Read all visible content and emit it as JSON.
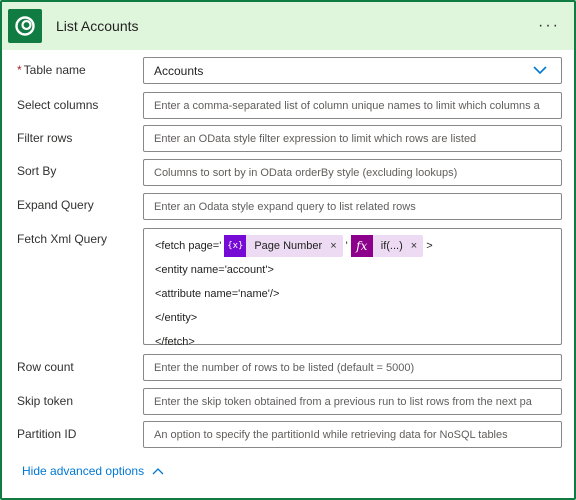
{
  "header": {
    "title": "List Accounts",
    "more_label": "···"
  },
  "colors": {
    "border": "#107c41",
    "header_bg": "#dff6dd",
    "link": "#0078d4",
    "variable_token": "#770bd6",
    "expression_token": "#8c008c",
    "token_bg": "#ecdbf3"
  },
  "fields": {
    "table_name": {
      "label": "Table name",
      "required_mark": "*",
      "value": "Accounts"
    },
    "select_columns": {
      "label": "Select columns",
      "placeholder": "Enter a comma-separated list of column unique names to limit which columns a"
    },
    "filter_rows": {
      "label": "Filter rows",
      "placeholder": "Enter an OData style filter expression to limit which rows are listed"
    },
    "sort_by": {
      "label": "Sort By",
      "placeholder": "Columns to sort by in OData orderBy style (excluding lookups)"
    },
    "expand_query": {
      "label": "Expand Query",
      "placeholder": "Enter an Odata style expand query to list related rows"
    },
    "fetch_xml": {
      "label": "Fetch Xml Query",
      "line1_prefix": "<fetch page='",
      "token_variable": {
        "icon": "{x}",
        "label": "Page Number",
        "remove": "×"
      },
      "line1_sep": "'",
      "token_expression": {
        "icon": "fx",
        "label": "if(...)",
        "remove": "×"
      },
      "line1_suffix": ">",
      "lines": [
        "<entity name='account'>",
        "<attribute name='name'/>",
        "</entity>",
        "</fetch>"
      ]
    },
    "row_count": {
      "label": "Row count",
      "placeholder": "Enter the number of rows to be listed (default = 5000)"
    },
    "skip_token": {
      "label": "Skip token",
      "placeholder": "Enter the skip token obtained from a previous run to list rows from the next pa"
    },
    "partition_id": {
      "label": "Partition ID",
      "placeholder": "An option to specify the partitionId while retrieving data for NoSQL tables"
    }
  },
  "footer": {
    "hide_advanced": "Hide advanced options"
  }
}
